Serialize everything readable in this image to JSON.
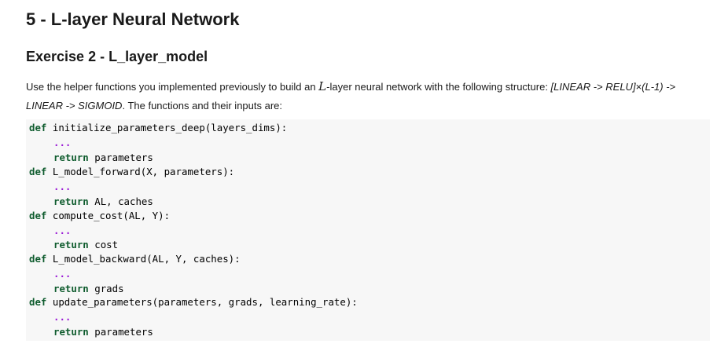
{
  "section_title": "5 - L-layer Neural Network",
  "exercise_title": "Exercise 2 - L_layer_model",
  "intro": {
    "part1": "Use the helper functions you implemented previously to build an ",
    "math_L": "L",
    "part2": "-layer neural network with the following structure: ",
    "structure_a": "[LINEAR -> RELU]",
    "times": "×",
    "structure_b": "(L-1) -> LINEAR -> SIGMOID",
    "part3": ". The functions and their inputs are:"
  },
  "code": {
    "keyword_def": "def",
    "keyword_return": "return",
    "ellipsis": "...",
    "functions": [
      {
        "signature": "initialize_parameters_deep(layers_dims):",
        "returns": "parameters"
      },
      {
        "signature": "L_model_forward(X, parameters):",
        "returns": "AL, caches"
      },
      {
        "signature": "compute_cost(AL, Y):",
        "returns": "cost"
      },
      {
        "signature": "L_model_backward(AL, Y, caches):",
        "returns": "grads"
      },
      {
        "signature": "update_parameters(parameters, grads, learning_rate):",
        "returns": "parameters"
      }
    ]
  },
  "colors": {
    "keyword": "#0f5c2e",
    "ellipsis": "#9b1bd6",
    "code_background": "#f7f7f7"
  }
}
